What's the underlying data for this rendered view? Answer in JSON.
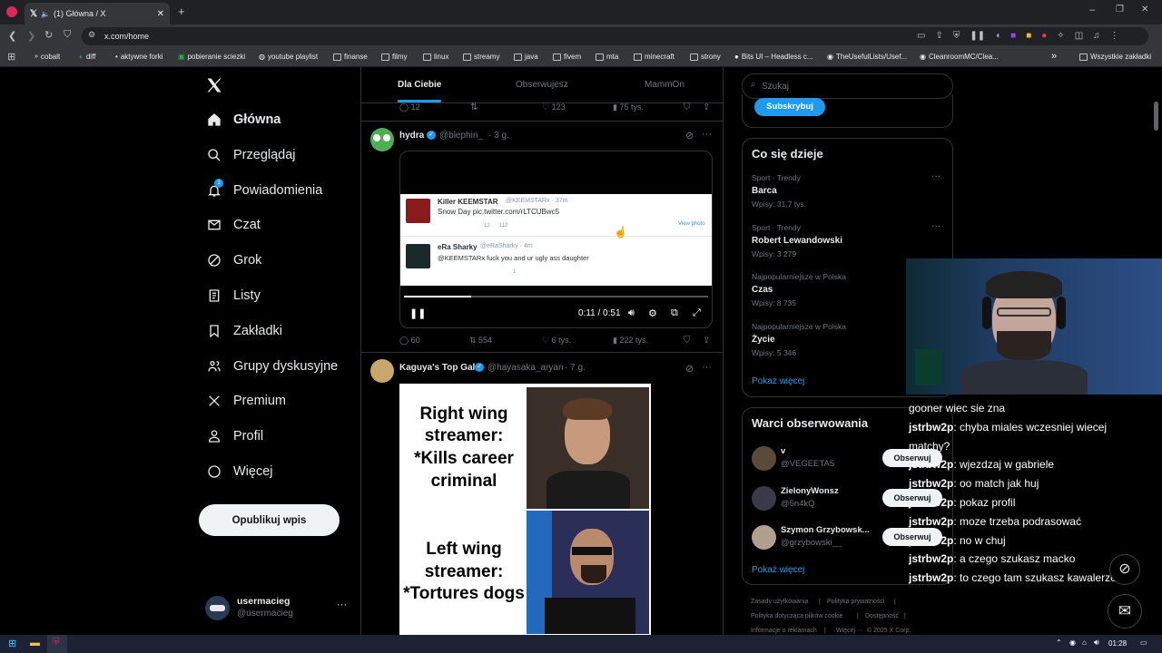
{
  "browser": {
    "tab_title": "(1) Główna / X",
    "url": "x.com/home",
    "bookmarks": [
      "cobalt",
      "diff",
      "aktywne forki",
      "pobieranie sciezki",
      "youtube playlist",
      "finanse",
      "filmy",
      "linux",
      "streamy",
      "java",
      "fivem",
      "mta",
      "minecraft",
      "strony",
      "Bits UI – Headless c...",
      "TheUsefulLists/Usef...",
      "CleanroomMC/Clea...",
      "Wszystkie zakładki"
    ],
    "more_bookmarks": "»"
  },
  "sidebar": {
    "items": [
      {
        "label": "Główna",
        "icon": "home-icon"
      },
      {
        "label": "Przeglądaj",
        "icon": "search-icon"
      },
      {
        "label": "Powiadomienia",
        "icon": "bell-icon",
        "badge": "1"
      },
      {
        "label": "Czat",
        "icon": "mail-icon"
      },
      {
        "label": "Grok",
        "icon": "grok-icon"
      },
      {
        "label": "Listy",
        "icon": "list-icon"
      },
      {
        "label": "Zakładki",
        "icon": "bookmark-icon"
      },
      {
        "label": "Grupy dyskusyjne",
        "icon": "community-icon"
      },
      {
        "label": "Premium",
        "icon": "x-logo-icon"
      },
      {
        "label": "Profil",
        "icon": "person-icon"
      },
      {
        "label": "Więcej",
        "icon": "more-circle-icon"
      }
    ],
    "post_button": "Opublikuj wpis",
    "account": {
      "name": "usermacieg",
      "handle": "@usermacieg"
    }
  },
  "feed": {
    "tabs": [
      "Dla Ciebie",
      "Obserwujesz",
      "MammOn"
    ],
    "prev_actions": {
      "replies": "12",
      "likes": "123",
      "views": "75 tys."
    },
    "post1": {
      "author": "hydra",
      "handle": "@blephin_",
      "time": "· 3 g.",
      "embedded": {
        "tweet1_author": "Killer KEEMSTAR",
        "tweet1_handle": "@KEEMSTARx · 37m",
        "tweet1_text": "Snow Day pic.twitter.com/rLTCUBwc5",
        "tweet1_counts": "12      112",
        "view_photo": "View photo",
        "tweet2_author": "eRa Sharky",
        "tweet2_handle": "@eRaSharky · 4m",
        "tweet2_text": "@KEEMSTARx fuck you and ur ugly ass daughter",
        "tweet2_counts": "1"
      },
      "video_time": "0:11 / 0:51",
      "video_progress": 0.22,
      "replies": "60",
      "reposts": "554",
      "likes": "6 tys.",
      "views": "222 tys."
    },
    "post2": {
      "author": "Kaguya's Top Gal",
      "handle": "@hayasaka_aryan",
      "time": "· 7 g.",
      "meme_top": "Right wing streamer: *Kills career criminal",
      "meme_bottom": "Left wing streamer: *Tortures dogs"
    }
  },
  "right": {
    "search_placeholder": "Szukaj",
    "subscribe": "Subskrybuj",
    "trends_title": "Co się dzieje",
    "trends": [
      {
        "cat": "Sport · Trendy",
        "name": "Barca",
        "count": "Wpisy: 31,7 tys."
      },
      {
        "cat": "Sport · Trendy",
        "name": "Robert Lewandowski",
        "count": "Wpisy: 3 279"
      },
      {
        "cat": "Najpopularniejsze w Polska",
        "name": "Czas",
        "count": "Wpisy: 8 735"
      },
      {
        "cat": "Najpopularniejsze w Polska",
        "name": "Życie",
        "count": "Wpisy: 5 346"
      }
    ],
    "show_more": "Pokaż więcej",
    "follow_title": "Warci obserwowania",
    "follow": [
      {
        "name": "v",
        "handle": "@VEGEETA5"
      },
      {
        "name": "ZielonyWonsz",
        "handle": "@5n4kQ"
      },
      {
        "name": "Szymon Grzybowsk...",
        "handle": "@grzybowski__"
      }
    ],
    "follow_button": "Obserwuj",
    "footer": [
      "Zasady użytkowania",
      "|",
      "Polityka prywatności",
      "|",
      "Polityka dotycząca plików cookie",
      "|",
      "Dostępność",
      "|",
      "Informacje o reklamach",
      "|",
      "Więcej ···",
      "© 2025 X Corp."
    ]
  },
  "chat_overlay": [
    {
      "user": "",
      "text": "gooner wiec sie zna"
    },
    {
      "user": "jstrbw2p",
      "text": ": chyba miales wczesniej wiecej"
    },
    {
      "user": "",
      "text": "matchy?"
    },
    {
      "user": "jstrbw2p",
      "text": ": wjezdzaj w gabriele"
    },
    {
      "user": "jstrbw2p",
      "text": ": oo match jak huj"
    },
    {
      "user": "jstrbw2p",
      "text": ": pokaz profil"
    },
    {
      "user": "jstrbw2p",
      "text": ": moze trzeba podrasować"
    },
    {
      "user": "jstrbw2p",
      "text": ": no w chuj"
    },
    {
      "user": "jstrbw2p",
      "text": ": a czego szukasz macko"
    },
    {
      "user": "jstrbw2p",
      "text": ": to czego tam szukasz kawalerze"
    }
  ],
  "taskbar": {
    "time": "01:28"
  }
}
